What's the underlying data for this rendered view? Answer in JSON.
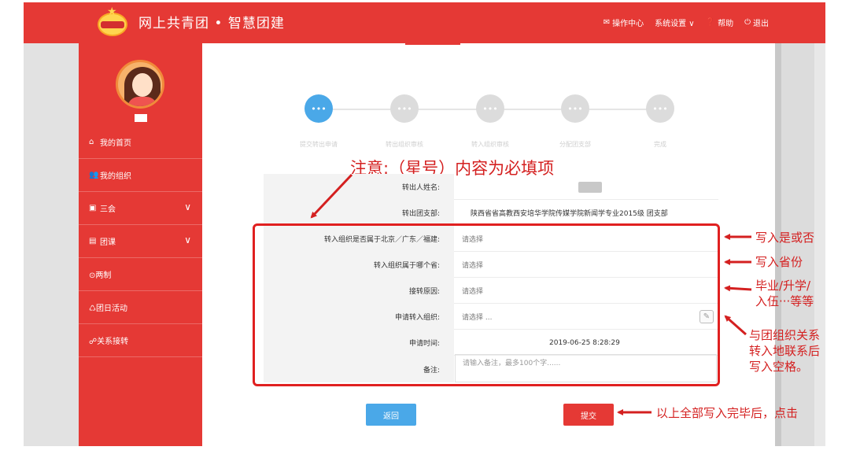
{
  "header": {
    "title": "网上共青团 • 智慧团建",
    "nav": [
      {
        "icon": "mail-icon",
        "glyph": "✉",
        "label": "操作中心"
      },
      {
        "icon": "chevron-down-icon",
        "glyph": "",
        "label": "系统设置 ∨"
      },
      {
        "icon": "help-icon",
        "glyph": "❓",
        "label": "帮助"
      },
      {
        "icon": "power-icon",
        "glyph": "⏻",
        "label": "退出"
      }
    ]
  },
  "sidebar": {
    "items": [
      {
        "label": "我的首页",
        "glyph": "⌂"
      },
      {
        "label": "我的组织",
        "glyph": "👥"
      },
      {
        "label": "三会",
        "glyph": "▣",
        "chevron": "∨"
      },
      {
        "label": "团课",
        "glyph": "▤",
        "chevron": "∨"
      },
      {
        "label": "⊙两制",
        "glyph": ""
      },
      {
        "label": "♺团日活动",
        "glyph": ""
      },
      {
        "label": "☍关系接转",
        "glyph": ""
      }
    ]
  },
  "steps": {
    "dots": "•••",
    "labels": [
      "提交转出申请",
      "转出组织审核",
      "转入组织审核",
      "分配团支部",
      "完成"
    ]
  },
  "note": "注意:（星号）内容为必填项",
  "form": {
    "required_mark": "•",
    "rows": [
      {
        "label": "转出人姓名:",
        "value": ""
      },
      {
        "label": "转出团支部:",
        "value": "陕西省省高教西安培华学院传媒学院新闻学专业2015级    团支部"
      },
      {
        "label": "转入组织是否属于北京／广东／福建:",
        "value": "请选择"
      },
      {
        "label": "转入组织属于哪个省:",
        "value": "请选择"
      },
      {
        "label": "接转原因:",
        "value": "请选择"
      },
      {
        "label": "申请转入组织:",
        "value": "请选择 ..."
      },
      {
        "label": "申请时间:",
        "value": "2019-06-25 8:28:29"
      },
      {
        "label": "备注:",
        "value": "请输入备注，最多100个字......"
      }
    ]
  },
  "buttons": {
    "back": "返回",
    "submit": "提交"
  },
  "annotations": {
    "a1": "写入是或否",
    "a2": "写入省份",
    "a3_line1": "毕业/升学/",
    "a3_line2": "入伍···等等",
    "a4_line1": "与团组织关系",
    "a4_line2": "转入地联系后",
    "a4_line3": "写入空格。",
    "a5": "以上全部写入完毕后，点击"
  },
  "colors": {
    "brand_red": "#e53935",
    "annotation_red": "#d42020",
    "accent_blue": "#4aa8e8"
  }
}
